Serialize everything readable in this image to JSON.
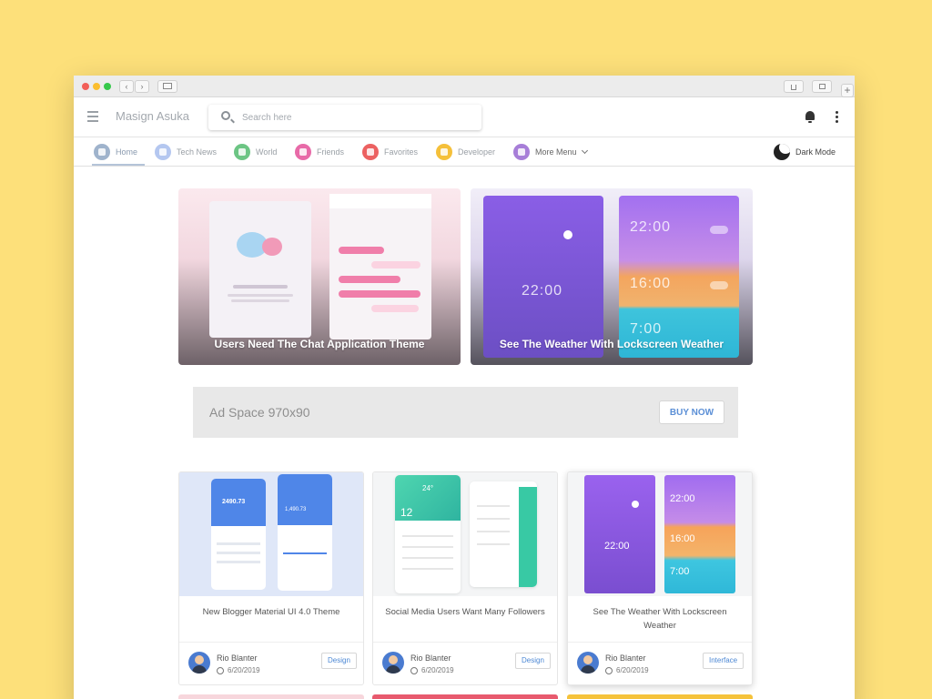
{
  "browser": {
    "back": "‹",
    "forward": "›",
    "plus": "+"
  },
  "appbar": {
    "brand": "Masign Asuka",
    "search_placeholder": "Search here"
  },
  "nav": {
    "items": [
      {
        "label": "Home",
        "icon": "home-icon",
        "color": "#9fb3cc"
      },
      {
        "label": "Tech News",
        "icon": "android-icon",
        "color": "#b4c7f0"
      },
      {
        "label": "World",
        "icon": "globe-icon",
        "color": "#6cc584"
      },
      {
        "label": "Friends",
        "icon": "people-icon",
        "color": "#e86aa8"
      },
      {
        "label": "Favorites",
        "icon": "heart-icon",
        "color": "#ec6161"
      },
      {
        "label": "Developer",
        "icon": "chat-icon",
        "color": "#f5c03a"
      },
      {
        "label": "More Menu",
        "icon": "filter-icon",
        "color": "#a77ed8"
      }
    ],
    "dark_mode": "Dark Mode"
  },
  "features": [
    {
      "title": "Users Need The Chat Application Theme"
    },
    {
      "title": "See The Weather With Lockscreen Weather",
      "time1": "22:00",
      "time2": "22:00",
      "time3": "16:00",
      "time4": "7:00"
    }
  ],
  "ad": {
    "label": "Ad Space 970x90",
    "button": "BUY NOW"
  },
  "cards": [
    {
      "title": "New Blogger Material UI 4.0 Theme",
      "author": "Rio Blanter",
      "date": "6/20/2019",
      "tag": "Design",
      "amount1": "2490.73",
      "amount2": "1,490.73",
      "amount3": "1,299.99"
    },
    {
      "title": "Social Media Users Want Many Followers",
      "author": "Rio Blanter",
      "date": "6/20/2019",
      "tag": "Design",
      "day": "12",
      "temp": "24°"
    },
    {
      "title": "See The Weather With Lockscreen Weather",
      "author": "Rio Blanter",
      "date": "6/20/2019",
      "tag": "Interface",
      "time1": "22:00",
      "time2": "22:00",
      "time3": "16:00",
      "time4": "7:00"
    }
  ],
  "colors": {
    "accent": "#4d88d4",
    "background": "#fde07a"
  }
}
